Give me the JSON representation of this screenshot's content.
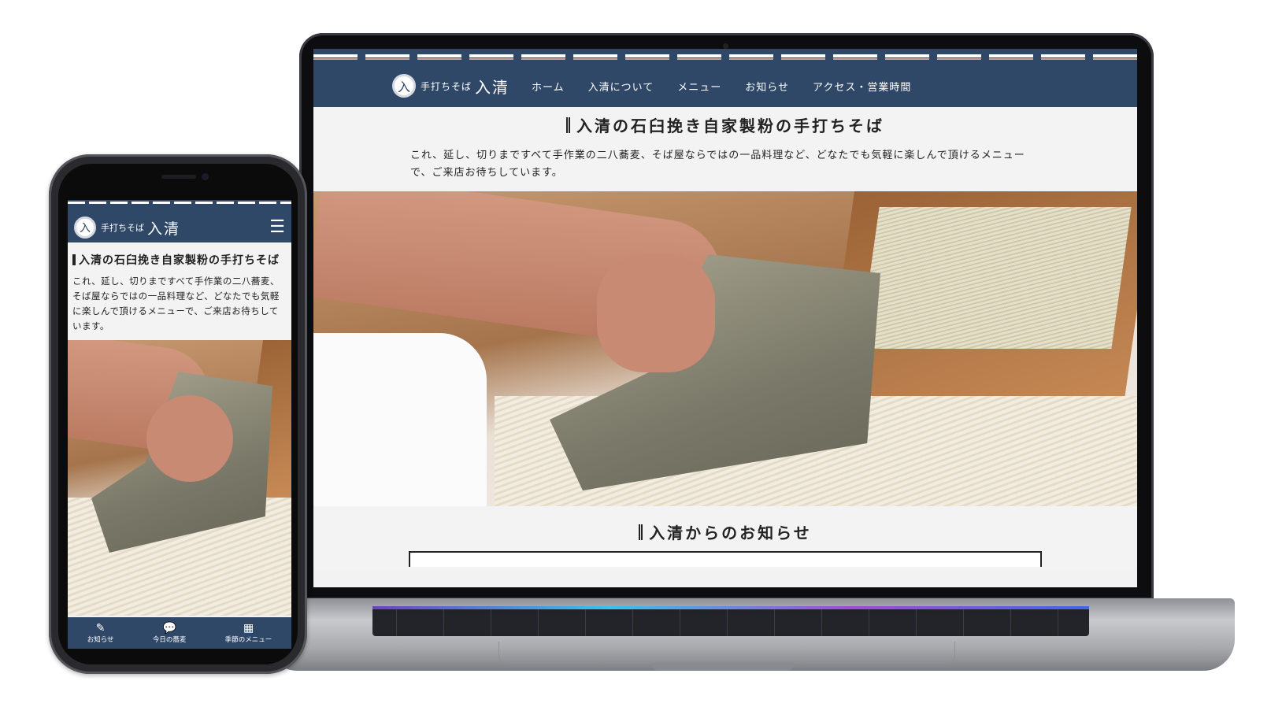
{
  "site": {
    "logo_mark": "入",
    "logo_small": "手打ちそば",
    "logo_big": "入清"
  },
  "nav": {
    "items": [
      {
        "label": "ホーム"
      },
      {
        "label": "入清について"
      },
      {
        "label": "メニュー"
      },
      {
        "label": "お知らせ"
      },
      {
        "label": "アクセス・営業時間"
      }
    ]
  },
  "intro": {
    "title": "入清の石臼挽き自家製粉の手打ちそば",
    "text": "これ、延し、切りまですべて手作業の二八蕎麦、そば屋ならではの一品料理など、どなたでも気軽に楽しんで頂けるメニューで、ご来店お待ちしています。"
  },
  "news": {
    "title": "入清からのお知らせ"
  },
  "mobile": {
    "menu_icon": "hamburger-icon",
    "tabs": [
      {
        "icon": "pencil-icon",
        "label": "お知らせ"
      },
      {
        "icon": "chat-bubble-icon",
        "label": "今日の蕎麦"
      },
      {
        "icon": "calendar-icon",
        "label": "季節のメニュー"
      }
    ]
  },
  "colors": {
    "brand_navy": "#2f4868",
    "background": "#f3f3f3",
    "stripe_accent": "#c9a69a"
  }
}
